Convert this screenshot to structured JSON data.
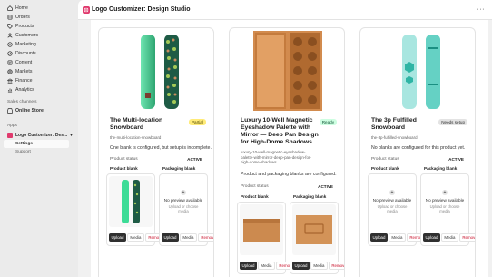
{
  "sidebar": {
    "items": [
      {
        "label": "Home",
        "icon": "home-icon"
      },
      {
        "label": "Orders",
        "icon": "orders-icon"
      },
      {
        "label": "Products",
        "icon": "tag-icon"
      },
      {
        "label": "Customers",
        "icon": "person-icon"
      },
      {
        "label": "Marketing",
        "icon": "target-icon"
      },
      {
        "label": "Discounts",
        "icon": "discount-icon"
      },
      {
        "label": "Content",
        "icon": "content-icon"
      },
      {
        "label": "Markets",
        "icon": "globe-icon"
      },
      {
        "label": "Finance",
        "icon": "bank-icon"
      },
      {
        "label": "Analytics",
        "icon": "chart-icon"
      }
    ],
    "sales_channels_label": "Sales channels",
    "online_store": "Online Store",
    "apps_label": "Apps",
    "app_name": "Logo Customizer: Des...",
    "app_sub": [
      "Settings",
      "Support"
    ]
  },
  "header": {
    "title": "Logo Customizer: Design Studio",
    "more": "···"
  },
  "cards": [
    {
      "title_lines": [
        "The Multi-location",
        "Snowboard"
      ],
      "badge": "Partial",
      "handle_lines": [
        "the-multi-location-snowboard"
      ],
      "desc_lines": [
        "One blank is configured, but setup is incomplete."
      ],
      "status_label": "Product status",
      "status_value": "ACTIVE",
      "product_blank_label": "Product blank",
      "packaging_blank_label": "Packaging blank",
      "packaging_empty_title": "No preview available",
      "packaging_empty_sub_lines": [
        "Upload or choose",
        "media"
      ],
      "buttons": {
        "upload": "Upload",
        "media": "Media",
        "remove": "Remove"
      }
    },
    {
      "title_lines": [
        "Luxury 10-Well Magnetic",
        "Eyeshadow Palette with",
        "Mirror — Deep Pan Design",
        "for High-Dome Shadows"
      ],
      "badge": "Ready",
      "handle_lines": [
        "luxury-10-well-magnetic-eyeshadow-",
        "palette-with-mirror-deep-pan-design-for-",
        "high-dome-shadows"
      ],
      "desc_lines": [
        "Product and packaging blanks are configured."
      ],
      "status_label": "Product status",
      "status_value": "ACTIVE",
      "product_blank_label": "Product blank",
      "packaging_blank_label": "Packaging blank",
      "buttons": {
        "upload": "Upload",
        "media": "Media",
        "remove": "Remove"
      }
    },
    {
      "title_lines": [
        "The 3p Fulfilled",
        "Snowboard"
      ],
      "badge": "Needs setup",
      "handle_lines": [
        "the-3p-fulfilled-snowboard"
      ],
      "desc_lines": [
        "No blanks are configured for this product yet."
      ],
      "status_label": "Product status",
      "status_value": "ACTIVE",
      "product_blank_label": "Product blank",
      "packaging_blank_label": "Packaging blank",
      "empty_title": "No preview available",
      "empty_sub_lines": [
        "Upload or choose",
        "media"
      ],
      "buttons": {
        "upload": "Upload",
        "media": "Media",
        "remove": "Remove"
      }
    }
  ],
  "colors": {
    "accent": "#e03a6d",
    "badge_partial": "#ffeb78",
    "badge_ready": "#cdfee1",
    "remove_text": "#c70a24"
  }
}
